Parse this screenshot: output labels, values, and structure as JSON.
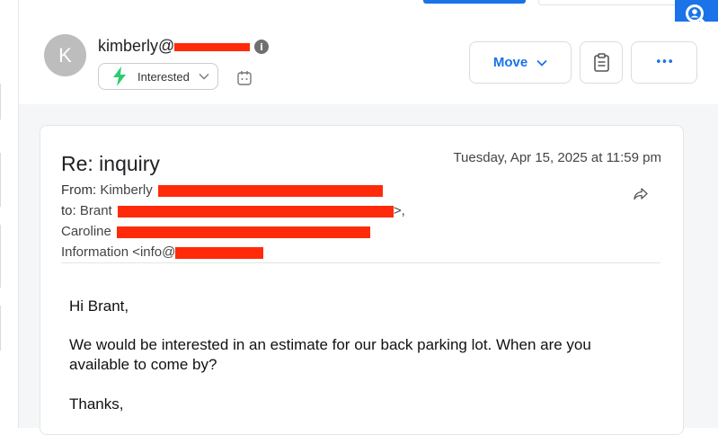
{
  "header": {
    "avatar_initial": "K",
    "sender": "kimberly@",
    "info_symbol": "i",
    "status": "Interested",
    "move_label": "Move",
    "more_label": "•••"
  },
  "email": {
    "subject": "Re: inquiry",
    "date": "Tuesday, Apr 15, 2025 at 11:59 pm",
    "from_label": "From:",
    "from_name": "Kimberly",
    "to_label": "to:",
    "to_name": "Brant",
    "to_trailing": ">,",
    "cc1_name": "Caroline",
    "cc2_name": "Information <info@"
  },
  "body": {
    "greeting": "Hi Brant,",
    "paragraph": "We would be interested in an estimate for our back parking lot. When are you available to come by?",
    "signoff": "Thanks,"
  },
  "colors": {
    "accent": "#1a73e8",
    "status_icon": "#2ecc71",
    "redaction": "#ff2a0a"
  },
  "icons": [
    "search-user-icon",
    "info-icon",
    "bolt-icon",
    "chevron-down-icon",
    "calendar-icon",
    "notes-icon",
    "more-icon",
    "reply-icon"
  ]
}
